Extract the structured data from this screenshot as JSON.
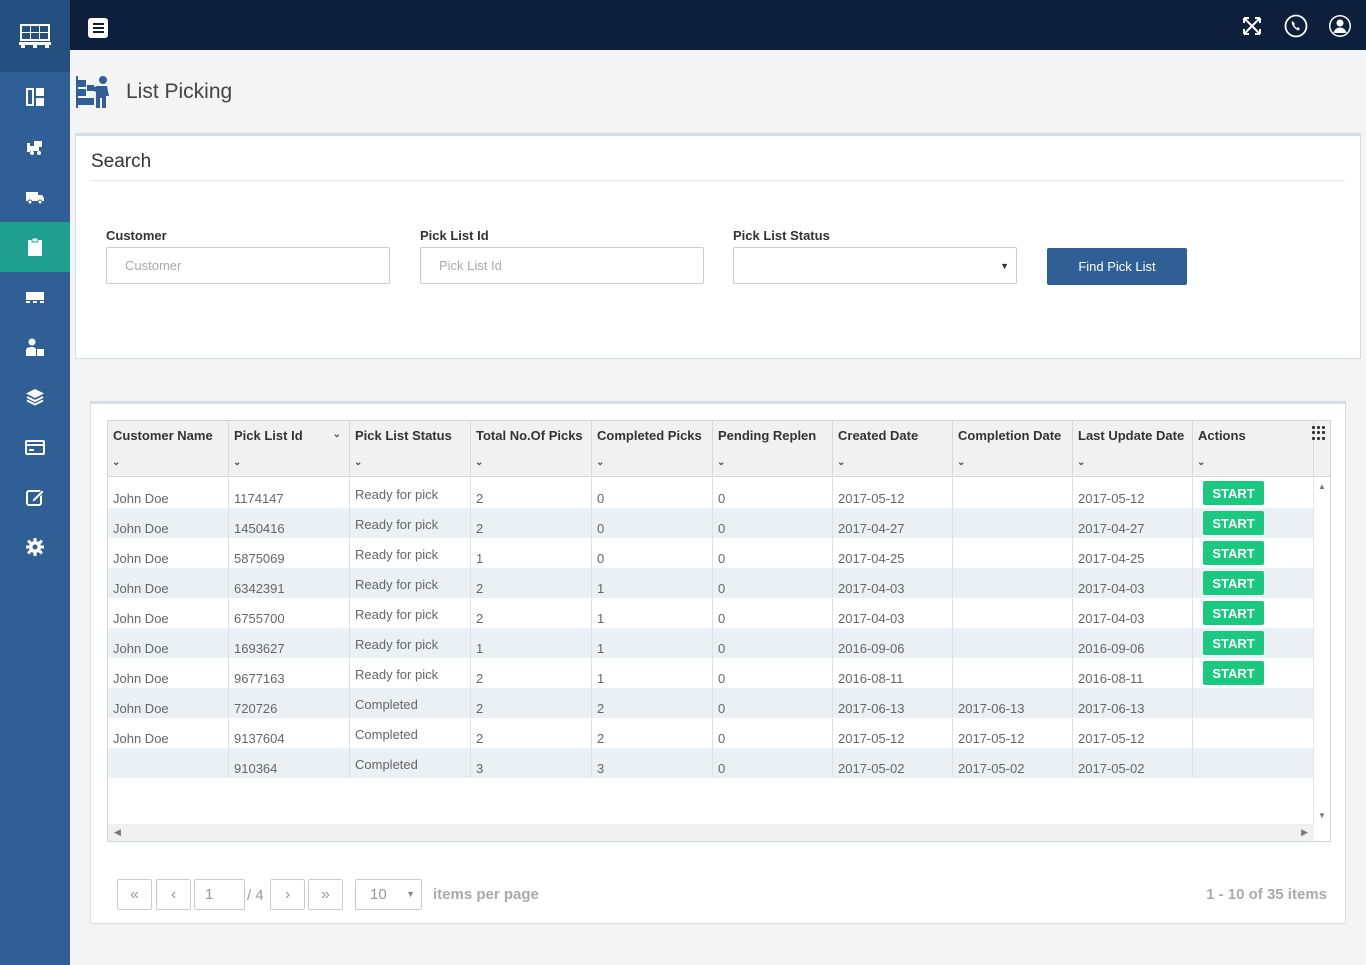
{
  "header": {
    "title": "List Picking"
  },
  "search": {
    "title": "Search",
    "customer_label": "Customer",
    "customer_placeholder": "Customer",
    "customer_value": "",
    "picklist_label": "Pick List Id",
    "picklist_placeholder": "Pick List Id",
    "picklist_value": "",
    "status_label": "Pick List Status",
    "status_value": "",
    "find_label": "Find Pick List"
  },
  "grid": {
    "columns": [
      "Customer Name",
      "Pick List Id",
      "Pick List Status",
      "Total No.Of Picks",
      "Completed Picks",
      "Pending Replen",
      "Created Date",
      "Completion Date",
      "Last Update Date",
      "Actions"
    ],
    "action_label": "START",
    "rows": [
      {
        "customer": "John Doe",
        "id": "1174147",
        "status": "Ready for pick",
        "total": "2",
        "completed": "0",
        "pending": "0",
        "created": "2017-05-12",
        "completion": "",
        "updated": "2017-05-12",
        "action": "START"
      },
      {
        "customer": "John Doe",
        "id": "1450416",
        "status": "Ready for pick",
        "total": "2",
        "completed": "0",
        "pending": "0",
        "created": "2017-04-27",
        "completion": "",
        "updated": "2017-04-27",
        "action": "START"
      },
      {
        "customer": "John Doe",
        "id": "5875069",
        "status": "Ready for pick",
        "total": "1",
        "completed": "0",
        "pending": "0",
        "created": "2017-04-25",
        "completion": "",
        "updated": "2017-04-25",
        "action": "START"
      },
      {
        "customer": "John Doe",
        "id": "6342391",
        "status": "Ready for pick",
        "total": "2",
        "completed": "1",
        "pending": "0",
        "created": "2017-04-03",
        "completion": "",
        "updated": "2017-04-03",
        "action": "START"
      },
      {
        "customer": "John Doe",
        "id": "6755700",
        "status": "Ready for pick",
        "total": "2",
        "completed": "1",
        "pending": "0",
        "created": "2017-04-03",
        "completion": "",
        "updated": "2017-04-03",
        "action": "START"
      },
      {
        "customer": "John Doe",
        "id": "1693627",
        "status": "Ready for pick",
        "total": "1",
        "completed": "1",
        "pending": "0",
        "created": "2016-09-06",
        "completion": "",
        "updated": "2016-09-06",
        "action": "START"
      },
      {
        "customer": "John Doe",
        "id": "9677163",
        "status": "Ready for pick",
        "total": "2",
        "completed": "1",
        "pending": "0",
        "created": "2016-08-11",
        "completion": "",
        "updated": "2016-08-11",
        "action": "START"
      },
      {
        "customer": "John Doe",
        "id": "720726",
        "status": "Completed",
        "total": "2",
        "completed": "2",
        "pending": "0",
        "created": "2017-06-13",
        "completion": "2017-06-13",
        "updated": "2017-06-13",
        "action": ""
      },
      {
        "customer": "John Doe",
        "id": "9137604",
        "status": "Completed",
        "total": "2",
        "completed": "2",
        "pending": "0",
        "created": "2017-05-12",
        "completion": "2017-05-12",
        "updated": "2017-05-12",
        "action": ""
      },
      {
        "customer": "",
        "id": "910364",
        "status": "Completed",
        "total": "3",
        "completed": "3",
        "pending": "0",
        "created": "2017-05-02",
        "completion": "2017-05-02",
        "updated": "2017-05-02",
        "action": ""
      }
    ]
  },
  "pager": {
    "first": "«",
    "prev": "‹",
    "next": "›",
    "last": "»",
    "current_page": "1",
    "of_text": "/ 4",
    "per_page": "10",
    "per_page_label": "items per page",
    "info": "1 - 10 of 35 items"
  },
  "icons": {
    "sidebar": [
      "logo-pallet-icon",
      "dashboard-icon",
      "forklift-icon",
      "truck-icon",
      "clipboard-icon",
      "dock-icon",
      "worker-icon",
      "layers-icon",
      "card-icon",
      "edit-icon",
      "gear-icon"
    ],
    "topbar": [
      "fullscreen-icon",
      "phone-icon",
      "user-icon"
    ]
  },
  "colors": {
    "sidebar": "#2f5f95",
    "sidebar_active": "#1f9f8f",
    "topbar": "#0e1f3b",
    "primary_button": "#2f5f95",
    "start_button": "#1ac97f"
  }
}
